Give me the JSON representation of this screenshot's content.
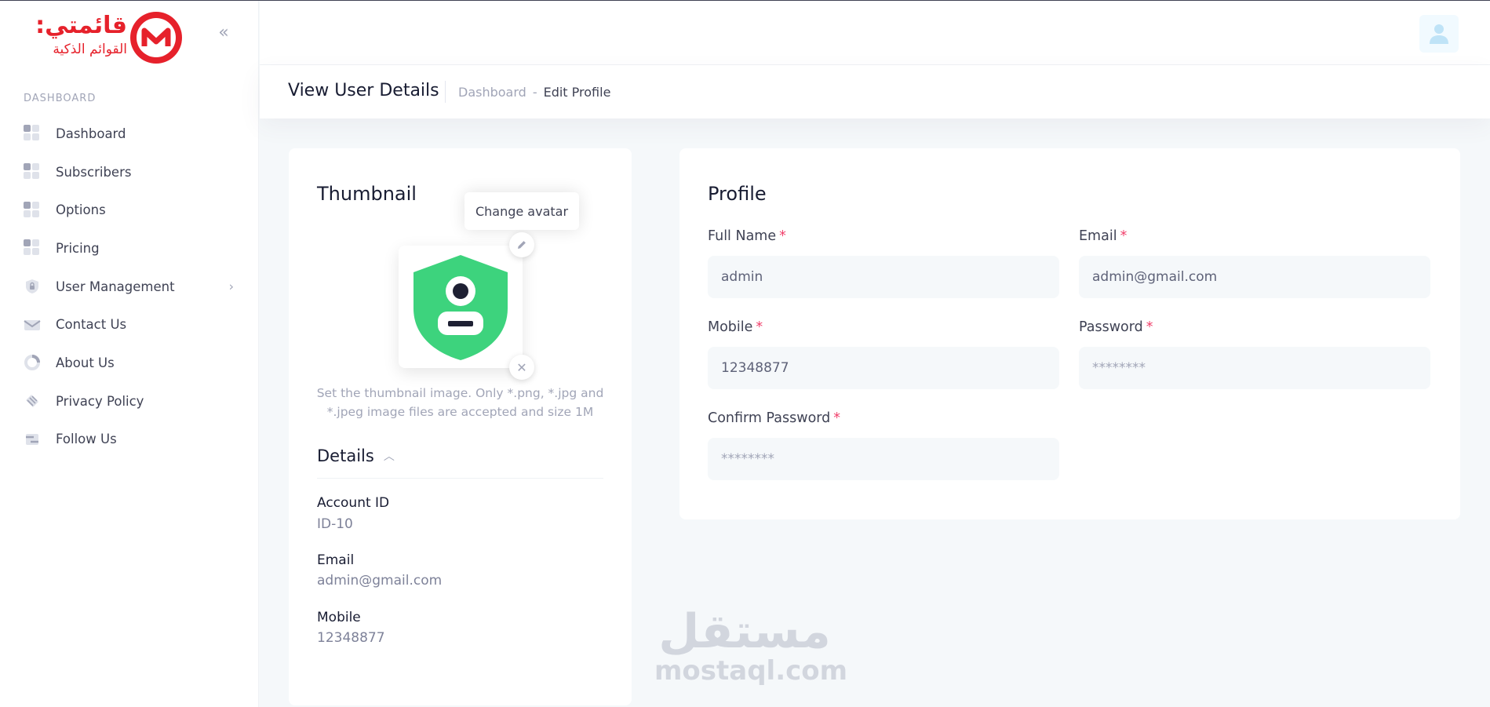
{
  "brand": {
    "logo_line1": "قائمتي:",
    "logo_line2": "القوائم الذكية",
    "color": "#e6212b"
  },
  "sidebar": {
    "section": "DASHBOARD",
    "items": [
      {
        "label": "Dashboard",
        "icon": "grid-icon"
      },
      {
        "label": "Subscribers",
        "icon": "grid-icon"
      },
      {
        "label": "Options",
        "icon": "grid-icon"
      },
      {
        "label": "Pricing",
        "icon": "grid-icon"
      },
      {
        "label": "User Management",
        "icon": "shield-lock-icon"
      },
      {
        "label": "Contact Us",
        "icon": "envelope-icon"
      },
      {
        "label": "About Us",
        "icon": "donut-chart-icon"
      },
      {
        "label": "Privacy Policy",
        "icon": "shield-stripes-icon"
      },
      {
        "label": "Follow Us",
        "icon": "share-icon"
      }
    ]
  },
  "toolbar": {
    "title": "View User Details",
    "breadcrumb": [
      "Dashboard",
      "-",
      "Edit Profile"
    ]
  },
  "thumbnail": {
    "title": "Thumbnail",
    "tooltip": "Change avatar",
    "hint": "Set the thumbnail image. Only *.png, *.jpg and *.jpeg image files are accepted and size 1M",
    "details_label": "Details",
    "details": [
      {
        "label": "Account ID",
        "value": "ID-10"
      },
      {
        "label": "Email",
        "value": "admin@gmail.com"
      },
      {
        "label": "Mobile",
        "value": "12348877"
      }
    ]
  },
  "profile": {
    "title": "Profile",
    "required_mark": "*",
    "fields": {
      "full_name": {
        "label": "Full Name",
        "value": "admin"
      },
      "email": {
        "label": "Email",
        "value": "admin@gmail.com"
      },
      "mobile": {
        "label": "Mobile",
        "value": "12348877"
      },
      "password": {
        "label": "Password",
        "placeholder": "********"
      },
      "confirm_password": {
        "label": "Confirm Password",
        "placeholder": "********"
      }
    }
  },
  "watermark": {
    "arabic": "مستقل",
    "latin": "mostaql.com"
  },
  "colors": {
    "accent_green": "#3dd37d",
    "required_red": "#f1416c",
    "page_bg": "#f5f8fa"
  }
}
